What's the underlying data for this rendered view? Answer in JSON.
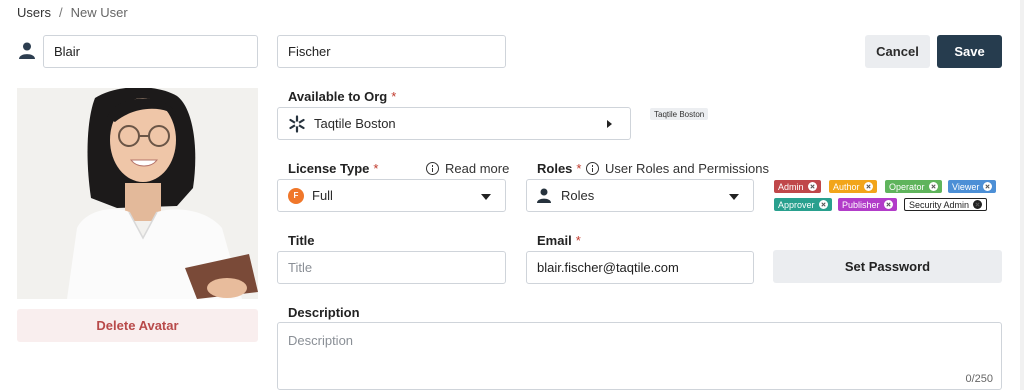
{
  "breadcrumb": {
    "root": "Users",
    "separator": "/",
    "current": "New User"
  },
  "user": {
    "first_name": "Blair",
    "last_name": "Fischer"
  },
  "actions": {
    "cancel_label": "Cancel",
    "save_label": "Save"
  },
  "org": {
    "label": "Available to Org",
    "required_mark": "*",
    "selected": "Taqtile Boston",
    "chip": "Taqtile Boston"
  },
  "license": {
    "label": "License Type",
    "required_mark": "*",
    "help_label": "Read more",
    "badge_letter": "F",
    "selected": "Full",
    "badge_color": "#f0772a"
  },
  "roles": {
    "label": "Roles",
    "required_mark": "*",
    "help_label": "User Roles and Permissions",
    "selected": "Roles",
    "tags": [
      {
        "label": "Admin",
        "color": "#c0474a"
      },
      {
        "label": "Author",
        "color": "#f2a51a"
      },
      {
        "label": "Operator",
        "color": "#5fb45c"
      },
      {
        "label": "Viewer",
        "color": "#4c8fd6"
      },
      {
        "label": "Approver",
        "color": "#29a08e"
      },
      {
        "label": "Publisher",
        "color": "#b23cc9"
      },
      {
        "label": "Security Admin",
        "color": "#ffffff"
      }
    ]
  },
  "title_field": {
    "label": "Title",
    "placeholder": "Title"
  },
  "email_field": {
    "label": "Email",
    "required_mark": "*",
    "value": "blair.fischer@taqtile.com"
  },
  "set_password_label": "Set Password",
  "avatar": {
    "delete_label": "Delete Avatar"
  },
  "description": {
    "label": "Description",
    "placeholder": "Description",
    "counter": "0/250"
  }
}
